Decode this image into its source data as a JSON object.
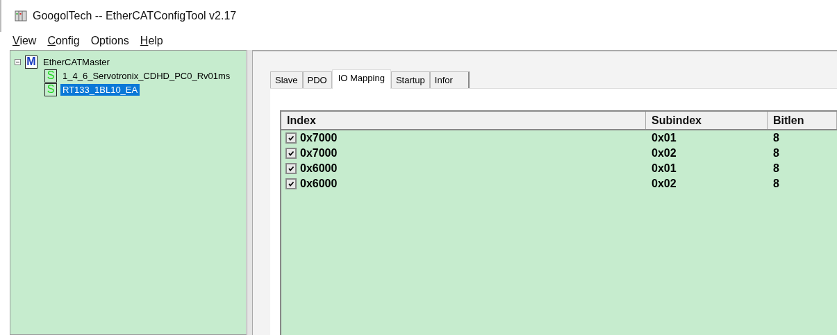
{
  "window": {
    "title": "GoogolTech -- EtherCATConfigTool v2.17"
  },
  "menu": [
    {
      "accel": "V",
      "rest": "iew"
    },
    {
      "accel": "C",
      "rest": "onfig"
    },
    {
      "rest": "Options"
    },
    {
      "accel": "H",
      "rest": "elp"
    }
  ],
  "tree": {
    "label": "EtherCATMaster",
    "badge": "M",
    "expanded": true,
    "children": [
      {
        "label": "1_4_6_Servotronix_CDHD_PC0_Rv01ms",
        "badge": "S",
        "selected": false
      },
      {
        "label": "RT133_1BL10_EA",
        "badge": "S",
        "selected": true
      }
    ]
  },
  "tabs": [
    {
      "label": "Slave",
      "selected": false
    },
    {
      "label": "PDO",
      "selected": false
    },
    {
      "label": "IO Mapping",
      "selected": true
    },
    {
      "label": "Startup",
      "selected": false
    },
    {
      "label": "Infor",
      "selected": false
    }
  ],
  "table": {
    "columns": [
      "Index",
      "Subindex",
      "Bitlen"
    ],
    "rows": [
      {
        "checked": true,
        "cells": [
          "0x7000",
          "0x01",
          "8"
        ]
      },
      {
        "checked": true,
        "cells": [
          "0x7000",
          "0x02",
          "8"
        ]
      },
      {
        "checked": true,
        "cells": [
          "0x6000",
          "0x01",
          "8"
        ]
      },
      {
        "checked": true,
        "cells": [
          "0x6000",
          "0x02",
          "8"
        ]
      }
    ]
  }
}
